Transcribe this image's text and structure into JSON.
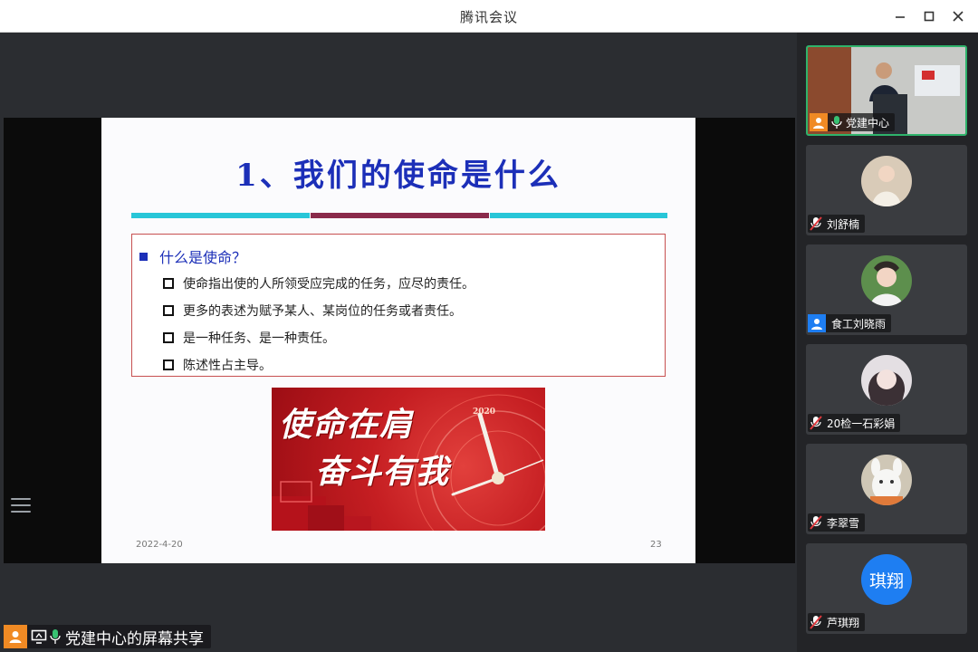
{
  "app": {
    "title": "腾讯会议"
  },
  "slide": {
    "title": "1、我们的使命是什么",
    "main_bullet": "什么是使命？",
    "sub_bullets": [
      "使命指出使的人所领受应完成的任务，应尽的责任。",
      "更多的表述为赋予某人、某岗位的任务或者责任。",
      "是一种任务、是一种责任。",
      "陈述性占主导。"
    ],
    "image_line1": "使命在肩",
    "image_line2": "奋斗有我",
    "image_year": "2020",
    "footer_date": "2022-4-20",
    "page_number": "23"
  },
  "share": {
    "label": "党建中心的屏幕共享"
  },
  "participants": [
    {
      "name": "党建中心",
      "mic": "on",
      "active": true
    },
    {
      "name": "刘舒楠",
      "mic": "muted"
    },
    {
      "name": "食工刘晓雨",
      "mic": "none"
    },
    {
      "name": "20检一石彩娟",
      "mic": "muted"
    },
    {
      "name": "李翠雪",
      "mic": "muted"
    },
    {
      "name": "芦琪翔",
      "mic": "muted",
      "avatar_text": "琪翔"
    }
  ],
  "colors": {
    "title_blue": "#1c2fb8",
    "accent_teal": "#28c6d8",
    "accent_maroon": "#8a2a4a",
    "speaking_green": "#2fb36b",
    "avatar_blue": "#1e7ef2",
    "muted_red": "#e0393e"
  }
}
